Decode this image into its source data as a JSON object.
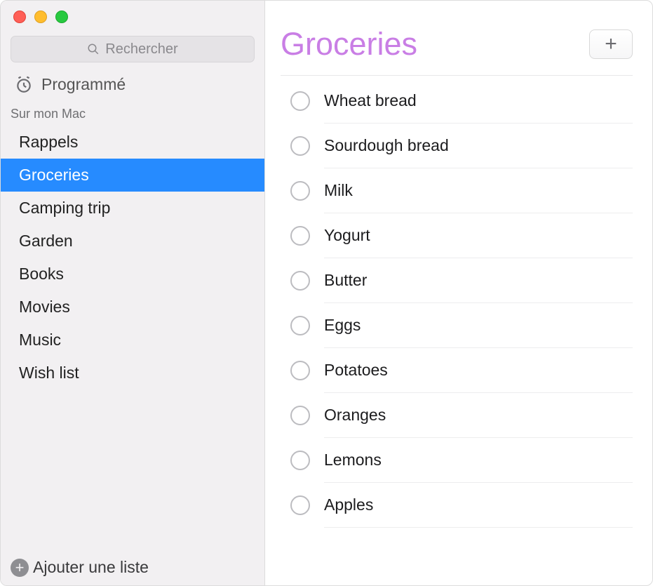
{
  "search": {
    "placeholder": "Rechercher"
  },
  "sidebar": {
    "scheduled": "Programmé",
    "sectionHeader": "Sur mon Mac",
    "lists": [
      {
        "label": "Rappels",
        "selected": false
      },
      {
        "label": "Groceries",
        "selected": true
      },
      {
        "label": "Camping trip",
        "selected": false
      },
      {
        "label": "Garden",
        "selected": false
      },
      {
        "label": "Books",
        "selected": false
      },
      {
        "label": "Movies",
        "selected": false
      },
      {
        "label": "Music",
        "selected": false
      },
      {
        "label": "Wish list",
        "selected": false
      }
    ],
    "addList": "Ajouter une liste"
  },
  "main": {
    "title": "Groceries",
    "titleColor": "#c97ee5",
    "reminders": [
      {
        "title": "Wheat bread"
      },
      {
        "title": "Sourdough bread"
      },
      {
        "title": "Milk"
      },
      {
        "title": "Yogurt"
      },
      {
        "title": "Butter"
      },
      {
        "title": "Eggs"
      },
      {
        "title": "Potatoes"
      },
      {
        "title": "Oranges"
      },
      {
        "title": "Lemons"
      },
      {
        "title": "Apples"
      }
    ]
  }
}
